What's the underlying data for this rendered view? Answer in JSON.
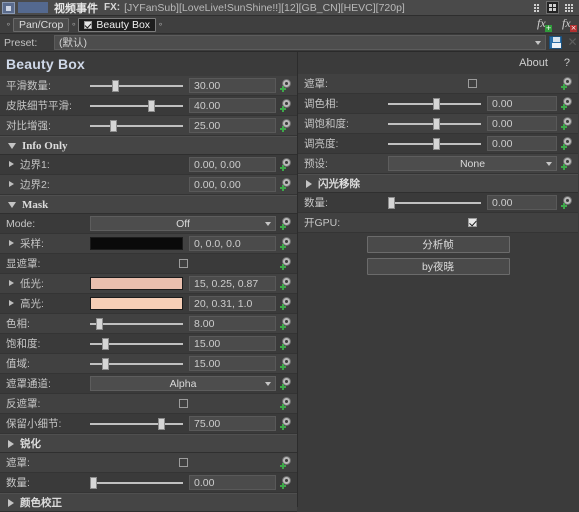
{
  "titlebar": {
    "title": "视频事件",
    "fx_label": "FX:",
    "filename": "[JYFanSub][LoveLive!SunShine!!][12][GB_CN][HEVC][720p]",
    "buttons": [
      "list-view",
      "grid-view-active",
      "thumb-view"
    ]
  },
  "chain": {
    "items": [
      {
        "label": "Pan/Crop",
        "checked": false,
        "selected": false
      },
      {
        "label": "Beauty Box",
        "checked": true,
        "selected": true
      }
    ],
    "add_plugin": "fx-add",
    "remove_plugin": "fx-remove"
  },
  "preset": {
    "label": "Preset:",
    "value": "(默认)",
    "save_icon": "save-icon",
    "delete_icon": "delete-icon"
  },
  "plugin": {
    "name": "Beauty Box",
    "about": "About",
    "help": "?"
  },
  "left": {
    "params": [
      {
        "label": "平滑数量:",
        "value": "30.00",
        "slider": 30
      },
      {
        "label": "皮肤细节平滑:",
        "value": "40.00",
        "slider": 62
      },
      {
        "label": "对比增强:",
        "value": "25.00",
        "slider": 25
      }
    ],
    "info_only": {
      "title": "Info Only",
      "open": true,
      "rows": [
        {
          "label": "边界1:",
          "value": "0.00, 0.00"
        },
        {
          "label": "边界2:",
          "value": "0.00, 0.00"
        }
      ]
    },
    "mask": {
      "title": "Mask",
      "open": true,
      "mode_label": "Mode:",
      "mode_value": "Off",
      "sample_label": "采样:",
      "sample_value": "0, 0.0, 0.0",
      "sample_color": "#0a0a0a",
      "show_mask_label": "显遮罩:",
      "show_mask_checked": false,
      "lowlight_label": "低光:",
      "lowlight_value": "15, 0.25, 0.87",
      "lowlight_color": "#eabfae",
      "highlight_label": "高光:",
      "highlight_value": "20, 0.31, 1.0",
      "highlight_color": "#f6ceb6",
      "sliders": [
        {
          "label": "色相:",
          "value": "8.00",
          "slider": 8
        },
        {
          "label": "饱和度:",
          "value": "15.00",
          "slider": 15
        },
        {
          "label": "值域:",
          "value": "15.00",
          "slider": 15
        }
      ],
      "channel_label": "遮罩通道:",
      "channel_value": "Alpha",
      "invert_label": "反遮罩:",
      "invert_checked": false,
      "detail_label": "保留小细节:",
      "detail_value": "75.00",
      "detail_slider": 75
    },
    "sharpen": {
      "title": "锐化",
      "open": false,
      "mask_label": "遮罩:",
      "mask_checked": false,
      "amount_label": "数量:",
      "amount_value": "0.00",
      "amount_slider": 0
    },
    "color_correct": {
      "title": "颜色校正",
      "open": false
    }
  },
  "right": {
    "mask_label": "遮罩:",
    "mask_checked": false,
    "params": [
      {
        "label": "调色相:",
        "value": "0.00",
        "slider": 50
      },
      {
        "label": "调饱和度:",
        "value": "0.00",
        "slider": 50
      },
      {
        "label": "调亮度:",
        "value": "0.00",
        "slider": 50
      }
    ],
    "preset_label": "预设:",
    "preset_value": "None",
    "flash_removal": {
      "title": "闪光移除",
      "open": false
    },
    "amount_label": "数量:",
    "amount_value": "0.00",
    "amount_slider": 2,
    "gpu_label": "开GPU:",
    "gpu_checked": true,
    "buttons": [
      {
        "label": "分析帧"
      },
      {
        "label": "by夜晓"
      }
    ]
  }
}
